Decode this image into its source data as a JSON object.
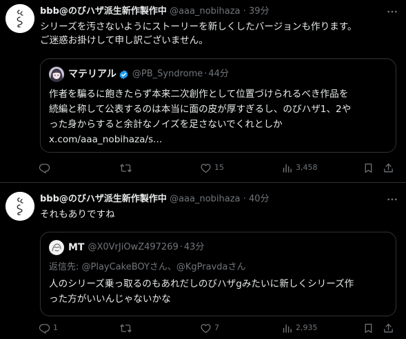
{
  "tweets": [
    {
      "author": {
        "name": "bbb@のびハザ派生新作製作中",
        "handle": "@aaa_nobihaza",
        "time": "39分",
        "separator": "·"
      },
      "text_lines": [
        "シリーズを汚さないようにストーリーを新しくしたバージョンも作ります。",
        "ご迷惑お掛けして申し訳ございません。"
      ],
      "quote": {
        "name": "マテリアル",
        "verified": true,
        "handle": "@PB_Syndrome",
        "time": "44分",
        "separator": "·",
        "text_lines": [
          "作者を騙るに飽きたらず本来二次創作として位置づけられるべき作品を",
          "続編と称して公表するのは本当に面の皮が厚すぎるし、のびハザ1、2や",
          "った身からすると余計なノイズを足さないでくれとしか",
          "x.com/aaa_nobihaza/s..."
        ]
      },
      "stats": {
        "reply": "",
        "retweet": "",
        "like": "15",
        "views": "3,458"
      }
    },
    {
      "author": {
        "name": "bbb@のびハザ派生新作製作中",
        "handle": "@aaa_nobihaza",
        "time": "40分",
        "separator": "·"
      },
      "text_lines": [
        "それもありですね"
      ],
      "quote": {
        "name": "MT",
        "verified": false,
        "handle": "@X0VrJiOwZ497269",
        "time": "43分",
        "separator": "·",
        "reply_to": {
          "prefix": "返信先: ",
          "user1": "@PlayCakeBOY",
          "san1": "さん、",
          "user2": "@KgPravda",
          "san2": "さん"
        },
        "text_lines": [
          "人のシリーズ乗っ取るのもあれだしのびハザgみたいに新しくシリーズ作",
          "った方がいいんじゃないかな"
        ]
      },
      "stats": {
        "reply": "1",
        "retweet": "",
        "like": "7",
        "views": "2,935"
      }
    }
  ],
  "icons": {
    "more": "more-icon",
    "reply": "reply-icon",
    "retweet": "retweet-icon",
    "like": "heart-icon",
    "views": "views-icon",
    "bookmark": "bookmark-icon",
    "share": "share-icon",
    "verified": "verified-badge-icon"
  },
  "colors": {
    "background": "#000000",
    "text": "#e7e9ea",
    "muted": "#71767b",
    "border": "#2f3336",
    "verified": "#1d9bf0"
  }
}
